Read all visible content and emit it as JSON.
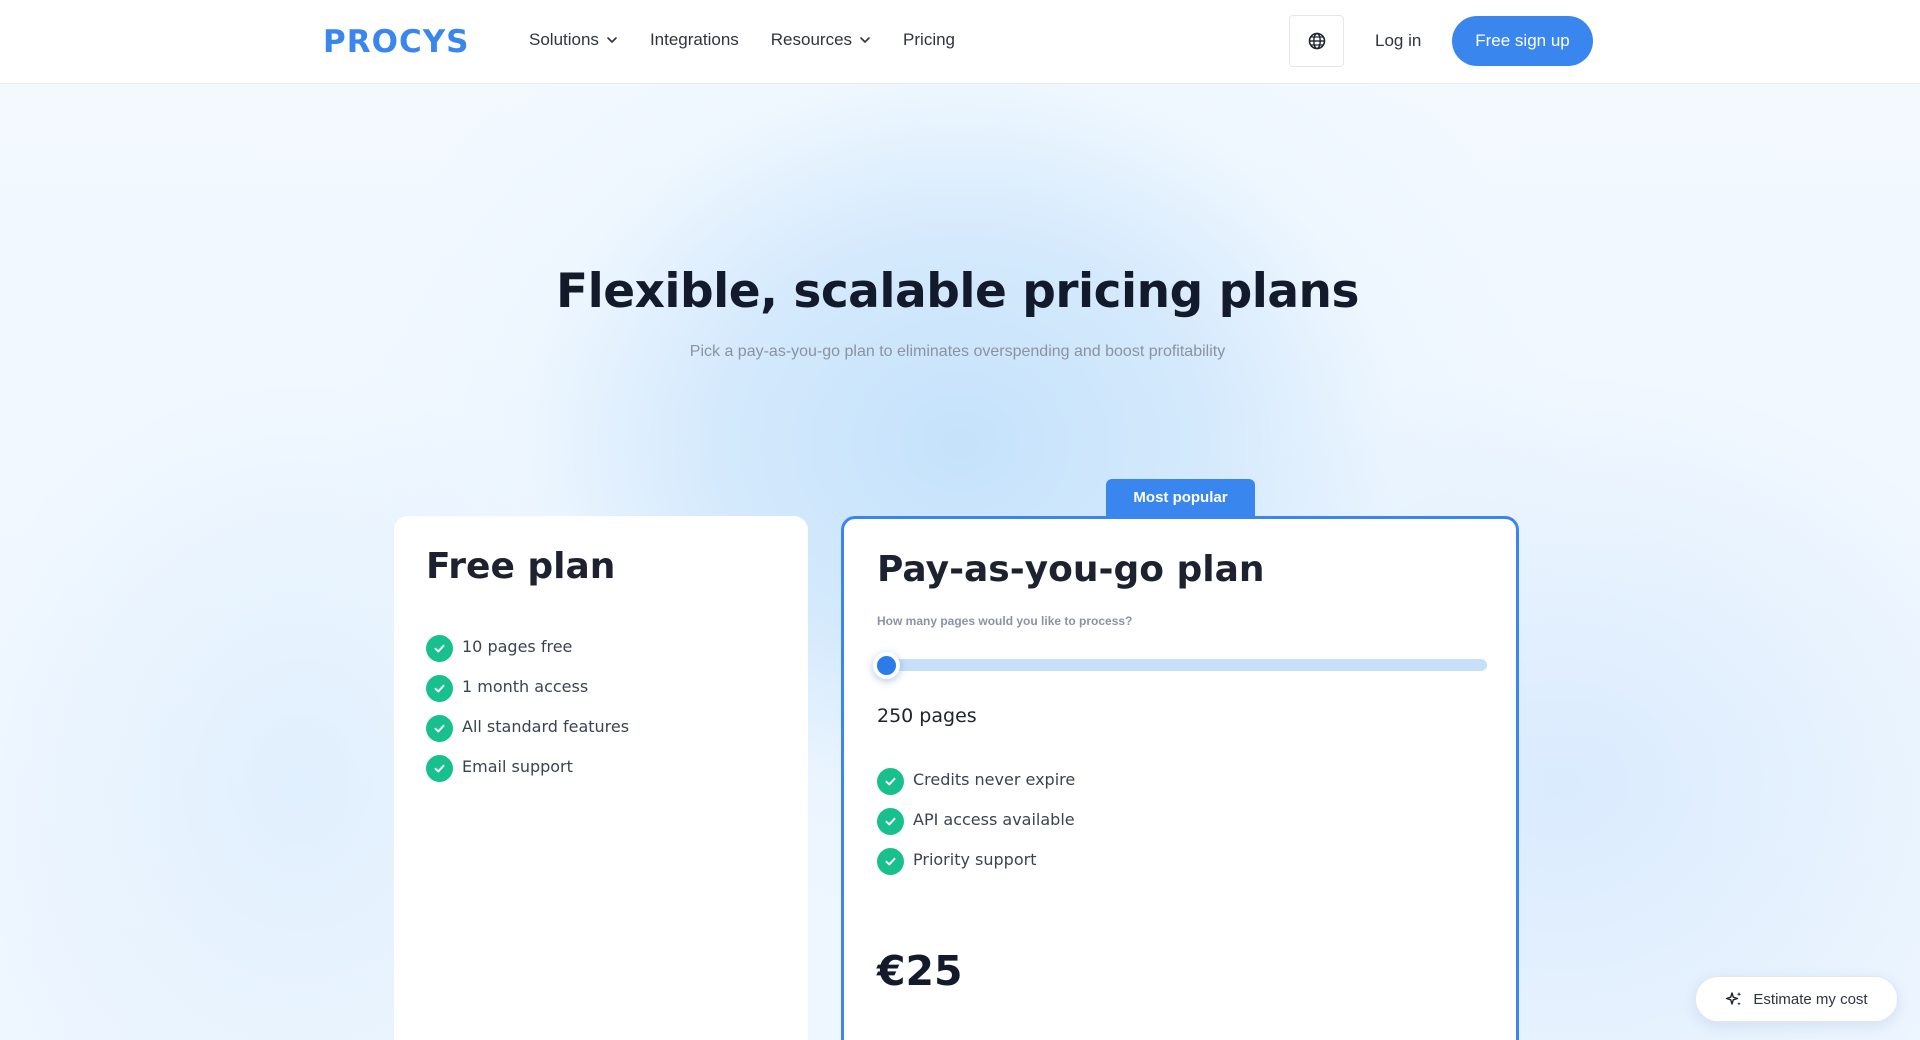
{
  "header": {
    "logo": "PROCYS",
    "nav": [
      {
        "label": "Solutions",
        "has_dropdown": true
      },
      {
        "label": "Integrations",
        "has_dropdown": false
      },
      {
        "label": "Resources",
        "has_dropdown": true
      },
      {
        "label": "Pricing",
        "has_dropdown": false
      }
    ],
    "globe_icon": "globe-icon",
    "login_label": "Log in",
    "signup_label": "Free sign up"
  },
  "hero": {
    "title": "Flexible, scalable pricing plans",
    "subtitle": "Pick a pay-as-you-go plan to eliminates overspending and boost profitability"
  },
  "plans": {
    "free": {
      "title": "Free plan",
      "features": [
        "10 pages free",
        "1 month access",
        "All standard features",
        "Email support"
      ]
    },
    "payg": {
      "badge": "Most popular",
      "title": "Pay-as-you-go plan",
      "question": "How many pages would you like to process?",
      "slider_value_fraction": 0,
      "pages_label": "250 pages",
      "features": [
        "Credits never expire",
        "API access available",
        "Priority support"
      ],
      "price": "€25"
    }
  },
  "estimate_button": {
    "label": "Estimate my cost",
    "icon": "sparkles-icon"
  },
  "colors": {
    "accent": "#3a86ef",
    "check": "#17c08c",
    "title": "#131a2b"
  }
}
